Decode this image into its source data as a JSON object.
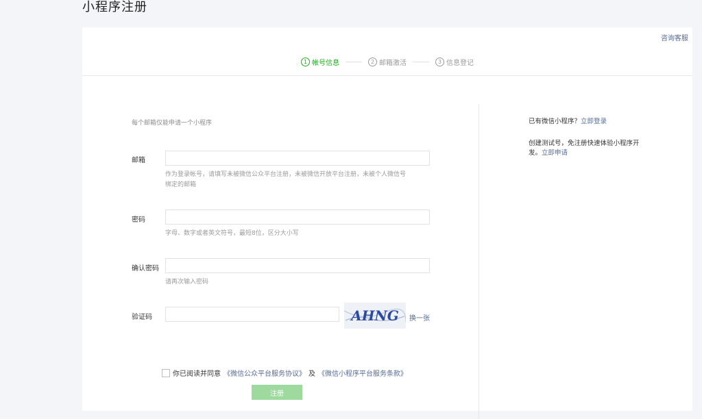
{
  "page": {
    "title": "小程序注册"
  },
  "header": {
    "service_link": "咨询客服"
  },
  "steps": [
    {
      "num": "1",
      "label": "帐号信息"
    },
    {
      "num": "2",
      "label": "邮箱激活"
    },
    {
      "num": "3",
      "label": "信息登记"
    }
  ],
  "form": {
    "hint": "每个邮箱仅能申请一个小程序",
    "email": {
      "label": "邮箱",
      "value": "",
      "tip_line1": "作为登录帐号，请填写未被微信公众平台注册，未被微信开放平台注册，未被个人微信号",
      "tip_line2": "绑定的邮箱"
    },
    "password": {
      "label": "密码",
      "value": "",
      "tip": "字母、数字或者英文符号，最短8位，区分大小写"
    },
    "confirm": {
      "label": "确认密码",
      "value": "",
      "tip": "请再次输入密码"
    },
    "captcha": {
      "label": "验证码",
      "value": "",
      "image_text": "AHNG",
      "refresh": "换一张"
    },
    "agreement": {
      "prefix": "你已阅读并同意",
      "link1": "《微信公众平台服务协议》",
      "mid": "及",
      "link2": "《微信小程序平台服务条款》",
      "checked": false
    },
    "submit": "注册"
  },
  "side": {
    "has_app": "已有微信小程序？",
    "login_link": "立即登录",
    "test_text_line1": "创建测试号，免注册快速体验小程序开",
    "test_text_line2": "发。",
    "apply_link": "立即申请"
  },
  "colors": {
    "accent": "#1aad19",
    "link": "#576b95",
    "button_disabled": "#9ed99d"
  }
}
